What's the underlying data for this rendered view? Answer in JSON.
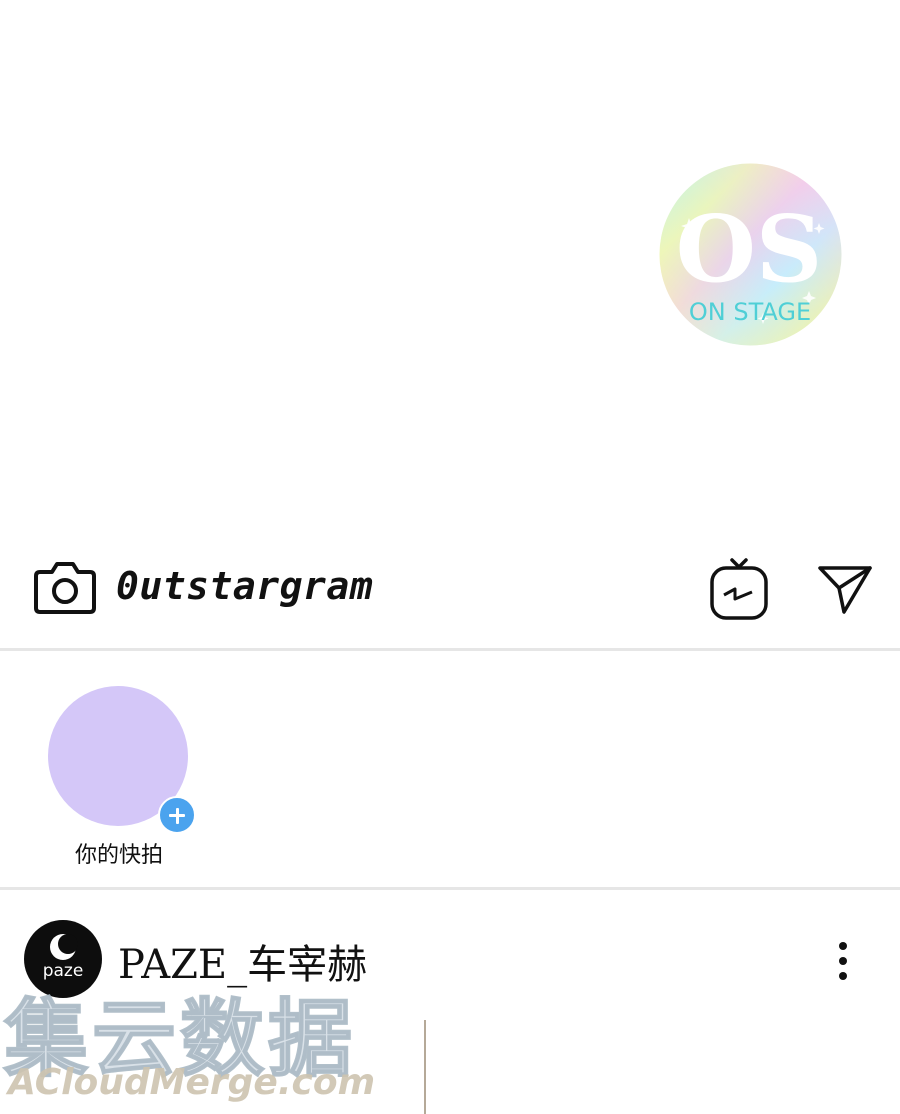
{
  "badge": {
    "monogram": "OS",
    "label": "ON STAGE",
    "accent_color": "#4fcfd6"
  },
  "appbar": {
    "title": "0utstargram",
    "icons": [
      "camera-icon",
      "igtv-icon",
      "send-icon"
    ]
  },
  "stories": {
    "items": [
      {
        "label": "你的快拍",
        "avatar_color": "#d4c7f8",
        "add_badge_color": "#4ba3ee"
      }
    ]
  },
  "post": {
    "username": "PAZE_车宰赫",
    "avatar_text": "paze",
    "more_icon": "more-vertical-icon"
  },
  "watermark": {
    "chinese": "集云数据",
    "english": "ACloudMerge.com"
  }
}
